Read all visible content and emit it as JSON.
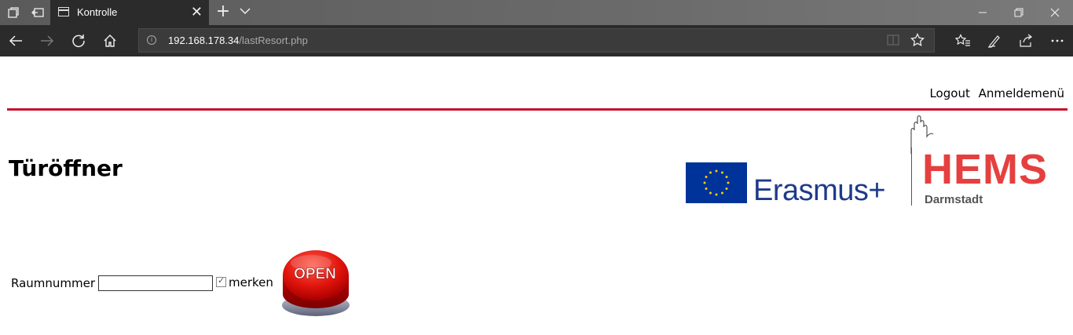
{
  "browser": {
    "tab_title": "Kontrolle",
    "url_host": "192.168.178.34",
    "url_path": "/lastResort.php"
  },
  "page": {
    "nav_links": [
      "Logout",
      "Anmeldemenü"
    ],
    "heading": "Türöffner",
    "logo_erasmus": "Erasmus+",
    "logo_hems": "HEMS",
    "logo_hems_city": "Darmstadt",
    "form": {
      "room_label": "Raumnummer",
      "room_value": "",
      "remember_label": "merken",
      "remember_checked": true,
      "open_button_label": "OPEN"
    }
  },
  "colors": {
    "accent_red": "#c8102e",
    "hems_red": "#e5403f",
    "erasmus_blue": "#1f3a8a",
    "eu_flag_blue": "#003399",
    "eu_star_yellow": "#ffcc00"
  }
}
